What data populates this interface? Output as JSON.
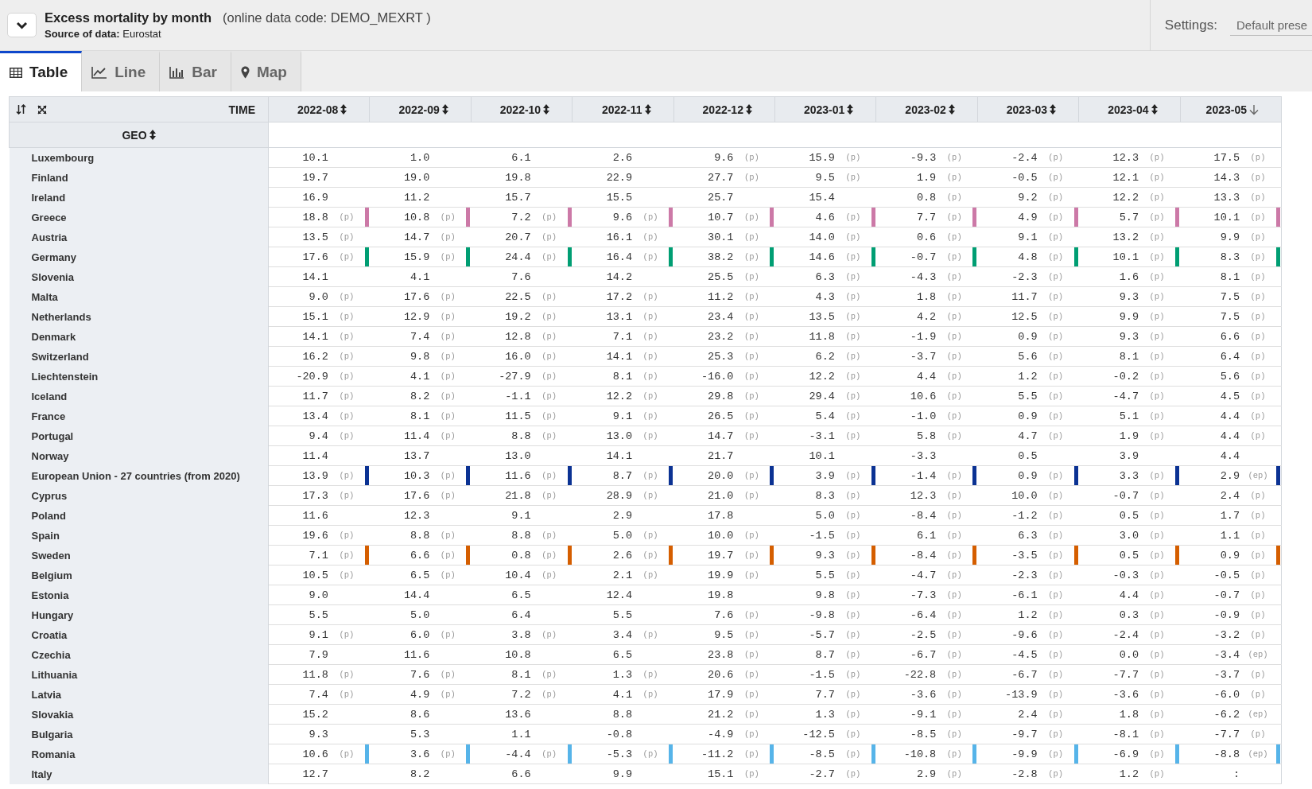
{
  "dataset": {
    "title": "Excess mortality by month",
    "code": "(online data code: DEMO_MEXRT )",
    "source": "**Source of data:** Eurostat"
  },
  "settings": {
    "label": "Settings:",
    "value": "Default prese"
  },
  "tabs": [
    {
      "label": "Table",
      "kind": "table",
      "selected": true
    },
    {
      "label": "Line",
      "kind": "line",
      "selected": false
    },
    {
      "label": "Bar",
      "kind": "bar",
      "selected": false
    },
    {
      "label": "Map",
      "kind": "map",
      "selected": false
    }
  ],
  "table": {
    "time_label": "TIME",
    "geo_label": "GEO",
    "columns": [
      {
        "label": "2022-08",
        "sorted": false
      },
      {
        "label": "2022-09",
        "sorted": false
      },
      {
        "label": "2022-10",
        "sorted": false
      },
      {
        "label": "2022-11",
        "sorted": false
      },
      {
        "label": "2022-12",
        "sorted": false
      },
      {
        "label": "2023-01",
        "sorted": false
      },
      {
        "label": "2023-02",
        "sorted": false
      },
      {
        "label": "2023-03",
        "sorted": false
      },
      {
        "label": "2023-04",
        "sorted": false
      },
      {
        "label": "2023-05",
        "sorted": true
      }
    ],
    "rows": [
      {
        "geo": "Luxembourg",
        "cells": [
          {
            "value": "10.1"
          },
          {
            "value": "1.0"
          },
          {
            "value": "6.1"
          },
          {
            "value": "2.6"
          },
          {
            "value": "9.6",
            "flag": "(p)"
          },
          {
            "value": "15.9",
            "flag": "(p)"
          },
          {
            "value": "-9.3",
            "flag": "(p)"
          },
          {
            "value": "-2.4",
            "flag": "(p)"
          },
          {
            "value": "12.3",
            "flag": "(p)"
          },
          {
            "value": "17.5",
            "flag": "(p)"
          }
        ]
      },
      {
        "geo": "Finland",
        "cells": [
          {
            "value": "19.7"
          },
          {
            "value": "19.0"
          },
          {
            "value": "19.8"
          },
          {
            "value": "22.9"
          },
          {
            "value": "27.7",
            "flag": "(p)"
          },
          {
            "value": "9.5",
            "flag": "(p)"
          },
          {
            "value": "1.9",
            "flag": "(p)"
          },
          {
            "value": "-0.5",
            "flag": "(p)"
          },
          {
            "value": "12.1",
            "flag": "(p)"
          },
          {
            "value": "14.3",
            "flag": "(p)"
          }
        ]
      },
      {
        "geo": "Ireland",
        "cells": [
          {
            "value": "16.9"
          },
          {
            "value": "11.2"
          },
          {
            "value": "15.7"
          },
          {
            "value": "15.5"
          },
          {
            "value": "25.7"
          },
          {
            "value": "15.4"
          },
          {
            "value": "0.8",
            "flag": "(p)"
          },
          {
            "value": "9.2",
            "flag": "(p)"
          },
          {
            "value": "12.2",
            "flag": "(p)"
          },
          {
            "value": "13.3",
            "flag": "(p)"
          }
        ]
      },
      {
        "geo": "Greece",
        "color": "#cc79a7",
        "cells": [
          {
            "value": "18.8",
            "flag": "(p)"
          },
          {
            "value": "10.8",
            "flag": "(p)"
          },
          {
            "value": "7.2",
            "flag": "(p)"
          },
          {
            "value": "9.6",
            "flag": "(p)"
          },
          {
            "value": "10.7",
            "flag": "(p)"
          },
          {
            "value": "4.6",
            "flag": "(p)"
          },
          {
            "value": "7.7",
            "flag": "(p)"
          },
          {
            "value": "4.9",
            "flag": "(p)"
          },
          {
            "value": "5.7",
            "flag": "(p)"
          },
          {
            "value": "10.1",
            "flag": "(p)"
          }
        ]
      },
      {
        "geo": "Austria",
        "cells": [
          {
            "value": "13.5",
            "flag": "(p)"
          },
          {
            "value": "14.7",
            "flag": "(p)"
          },
          {
            "value": "20.7",
            "flag": "(p)"
          },
          {
            "value": "16.1",
            "flag": "(p)"
          },
          {
            "value": "30.1",
            "flag": "(p)"
          },
          {
            "value": "14.0",
            "flag": "(p)"
          },
          {
            "value": "0.6",
            "flag": "(p)"
          },
          {
            "value": "9.1",
            "flag": "(p)"
          },
          {
            "value": "13.2",
            "flag": "(p)"
          },
          {
            "value": "9.9",
            "flag": "(p)"
          }
        ]
      },
      {
        "geo": "Germany",
        "color": "#009e73",
        "cells": [
          {
            "value": "17.6",
            "flag": "(p)"
          },
          {
            "value": "15.9",
            "flag": "(p)"
          },
          {
            "value": "24.4",
            "flag": "(p)"
          },
          {
            "value": "16.4",
            "flag": "(p)"
          },
          {
            "value": "38.2",
            "flag": "(p)"
          },
          {
            "value": "14.6",
            "flag": "(p)"
          },
          {
            "value": "-0.7",
            "flag": "(p)"
          },
          {
            "value": "4.8",
            "flag": "(p)"
          },
          {
            "value": "10.1",
            "flag": "(p)"
          },
          {
            "value": "8.3",
            "flag": "(p)"
          }
        ]
      },
      {
        "geo": "Slovenia",
        "cells": [
          {
            "value": "14.1"
          },
          {
            "value": "4.1"
          },
          {
            "value": "7.6"
          },
          {
            "value": "14.2"
          },
          {
            "value": "25.5",
            "flag": "(p)"
          },
          {
            "value": "6.3",
            "flag": "(p)"
          },
          {
            "value": "-4.3",
            "flag": "(p)"
          },
          {
            "value": "-2.3",
            "flag": "(p)"
          },
          {
            "value": "1.6",
            "flag": "(p)"
          },
          {
            "value": "8.1",
            "flag": "(p)"
          }
        ]
      },
      {
        "geo": "Malta",
        "cells": [
          {
            "value": "9.0",
            "flag": "(p)"
          },
          {
            "value": "17.6",
            "flag": "(p)"
          },
          {
            "value": "22.5",
            "flag": "(p)"
          },
          {
            "value": "17.2",
            "flag": "(p)"
          },
          {
            "value": "11.2",
            "flag": "(p)"
          },
          {
            "value": "4.3",
            "flag": "(p)"
          },
          {
            "value": "1.8",
            "flag": "(p)"
          },
          {
            "value": "11.7",
            "flag": "(p)"
          },
          {
            "value": "9.3",
            "flag": "(p)"
          },
          {
            "value": "7.5",
            "flag": "(p)"
          }
        ]
      },
      {
        "geo": "Netherlands",
        "cells": [
          {
            "value": "15.1",
            "flag": "(p)"
          },
          {
            "value": "12.9",
            "flag": "(p)"
          },
          {
            "value": "19.2",
            "flag": "(p)"
          },
          {
            "value": "13.1",
            "flag": "(p)"
          },
          {
            "value": "23.4",
            "flag": "(p)"
          },
          {
            "value": "13.5",
            "flag": "(p)"
          },
          {
            "value": "4.2",
            "flag": "(p)"
          },
          {
            "value": "12.5",
            "flag": "(p)"
          },
          {
            "value": "9.9",
            "flag": "(p)"
          },
          {
            "value": "7.5",
            "flag": "(p)"
          }
        ]
      },
      {
        "geo": "Denmark",
        "cells": [
          {
            "value": "14.1",
            "flag": "(p)"
          },
          {
            "value": "7.4",
            "flag": "(p)"
          },
          {
            "value": "12.8",
            "flag": "(p)"
          },
          {
            "value": "7.1",
            "flag": "(p)"
          },
          {
            "value": "23.2",
            "flag": "(p)"
          },
          {
            "value": "11.8",
            "flag": "(p)"
          },
          {
            "value": "-1.9",
            "flag": "(p)"
          },
          {
            "value": "0.9",
            "flag": "(p)"
          },
          {
            "value": "9.3",
            "flag": "(p)"
          },
          {
            "value": "6.6",
            "flag": "(p)"
          }
        ]
      },
      {
        "geo": "Switzerland",
        "cells": [
          {
            "value": "16.2",
            "flag": "(p)"
          },
          {
            "value": "9.8",
            "flag": "(p)"
          },
          {
            "value": "16.0",
            "flag": "(p)"
          },
          {
            "value": "14.1",
            "flag": "(p)"
          },
          {
            "value": "25.3",
            "flag": "(p)"
          },
          {
            "value": "6.2",
            "flag": "(p)"
          },
          {
            "value": "-3.7",
            "flag": "(p)"
          },
          {
            "value": "5.6",
            "flag": "(p)"
          },
          {
            "value": "8.1",
            "flag": "(p)"
          },
          {
            "value": "6.4",
            "flag": "(p)"
          }
        ]
      },
      {
        "geo": "Liechtenstein",
        "cells": [
          {
            "value": "-20.9",
            "flag": "(p)"
          },
          {
            "value": "4.1",
            "flag": "(p)"
          },
          {
            "value": "-27.9",
            "flag": "(p)"
          },
          {
            "value": "8.1",
            "flag": "(p)"
          },
          {
            "value": "-16.0",
            "flag": "(p)"
          },
          {
            "value": "12.2",
            "flag": "(p)"
          },
          {
            "value": "4.4",
            "flag": "(p)"
          },
          {
            "value": "1.2",
            "flag": "(p)"
          },
          {
            "value": "-0.2",
            "flag": "(p)"
          },
          {
            "value": "5.6",
            "flag": "(p)"
          }
        ]
      },
      {
        "geo": "Iceland",
        "cells": [
          {
            "value": "11.7",
            "flag": "(p)"
          },
          {
            "value": "8.2",
            "flag": "(p)"
          },
          {
            "value": "-1.1",
            "flag": "(p)"
          },
          {
            "value": "12.2",
            "flag": "(p)"
          },
          {
            "value": "29.8",
            "flag": "(p)"
          },
          {
            "value": "29.4",
            "flag": "(p)"
          },
          {
            "value": "10.6",
            "flag": "(p)"
          },
          {
            "value": "5.5",
            "flag": "(p)"
          },
          {
            "value": "-4.7",
            "flag": "(p)"
          },
          {
            "value": "4.5",
            "flag": "(p)"
          }
        ]
      },
      {
        "geo": "France",
        "cells": [
          {
            "value": "13.4",
            "flag": "(p)"
          },
          {
            "value": "8.1",
            "flag": "(p)"
          },
          {
            "value": "11.5",
            "flag": "(p)"
          },
          {
            "value": "9.1",
            "flag": "(p)"
          },
          {
            "value": "26.5",
            "flag": "(p)"
          },
          {
            "value": "5.4",
            "flag": "(p)"
          },
          {
            "value": "-1.0",
            "flag": "(p)"
          },
          {
            "value": "0.9",
            "flag": "(p)"
          },
          {
            "value": "5.1",
            "flag": "(p)"
          },
          {
            "value": "4.4",
            "flag": "(p)"
          }
        ]
      },
      {
        "geo": "Portugal",
        "cells": [
          {
            "value": "9.4",
            "flag": "(p)"
          },
          {
            "value": "11.4",
            "flag": "(p)"
          },
          {
            "value": "8.8",
            "flag": "(p)"
          },
          {
            "value": "13.0",
            "flag": "(p)"
          },
          {
            "value": "14.7",
            "flag": "(p)"
          },
          {
            "value": "-3.1",
            "flag": "(p)"
          },
          {
            "value": "5.8",
            "flag": "(p)"
          },
          {
            "value": "4.7",
            "flag": "(p)"
          },
          {
            "value": "1.9",
            "flag": "(p)"
          },
          {
            "value": "4.4",
            "flag": "(p)"
          }
        ]
      },
      {
        "geo": "Norway",
        "cells": [
          {
            "value": "11.4"
          },
          {
            "value": "13.7"
          },
          {
            "value": "13.0"
          },
          {
            "value": "14.1"
          },
          {
            "value": "21.7"
          },
          {
            "value": "10.1"
          },
          {
            "value": "-3.3"
          },
          {
            "value": "0.5"
          },
          {
            "value": "3.9"
          },
          {
            "value": "4.4"
          }
        ]
      },
      {
        "geo": "European Union - 27 countries (from 2020)",
        "color": "#0b3293",
        "cells": [
          {
            "value": "13.9",
            "flag": "(p)"
          },
          {
            "value": "10.3",
            "flag": "(p)"
          },
          {
            "value": "11.6",
            "flag": "(p)"
          },
          {
            "value": "8.7",
            "flag": "(p)"
          },
          {
            "value": "20.0",
            "flag": "(p)"
          },
          {
            "value": "3.9",
            "flag": "(p)"
          },
          {
            "value": "-1.4",
            "flag": "(p)"
          },
          {
            "value": "0.9",
            "flag": "(p)"
          },
          {
            "value": "3.3",
            "flag": "(p)"
          },
          {
            "value": "2.9",
            "flag": "(ep)"
          }
        ]
      },
      {
        "geo": "Cyprus",
        "cells": [
          {
            "value": "17.3",
            "flag": "(p)"
          },
          {
            "value": "17.6",
            "flag": "(p)"
          },
          {
            "value": "21.8",
            "flag": "(p)"
          },
          {
            "value": "28.9",
            "flag": "(p)"
          },
          {
            "value": "21.0",
            "flag": "(p)"
          },
          {
            "value": "8.3",
            "flag": "(p)"
          },
          {
            "value": "12.3",
            "flag": "(p)"
          },
          {
            "value": "10.0",
            "flag": "(p)"
          },
          {
            "value": "-0.7",
            "flag": "(p)"
          },
          {
            "value": "2.4",
            "flag": "(p)"
          }
        ]
      },
      {
        "geo": "Poland",
        "cells": [
          {
            "value": "11.6"
          },
          {
            "value": "12.3"
          },
          {
            "value": "9.1"
          },
          {
            "value": "2.9"
          },
          {
            "value": "17.8"
          },
          {
            "value": "5.0",
            "flag": "(p)"
          },
          {
            "value": "-8.4",
            "flag": "(p)"
          },
          {
            "value": "-1.2",
            "flag": "(p)"
          },
          {
            "value": "0.5",
            "flag": "(p)"
          },
          {
            "value": "1.7",
            "flag": "(p)"
          }
        ]
      },
      {
        "geo": "Spain",
        "cells": [
          {
            "value": "19.6",
            "flag": "(p)"
          },
          {
            "value": "8.8",
            "flag": "(p)"
          },
          {
            "value": "8.8",
            "flag": "(p)"
          },
          {
            "value": "5.0",
            "flag": "(p)"
          },
          {
            "value": "10.0",
            "flag": "(p)"
          },
          {
            "value": "-1.5",
            "flag": "(p)"
          },
          {
            "value": "6.1",
            "flag": "(p)"
          },
          {
            "value": "6.3",
            "flag": "(p)"
          },
          {
            "value": "3.0",
            "flag": "(p)"
          },
          {
            "value": "1.1",
            "flag": "(p)"
          }
        ]
      },
      {
        "geo": "Sweden",
        "color": "#d55e00",
        "cells": [
          {
            "value": "7.1",
            "flag": "(p)"
          },
          {
            "value": "6.6",
            "flag": "(p)"
          },
          {
            "value": "0.8",
            "flag": "(p)"
          },
          {
            "value": "2.6",
            "flag": "(p)"
          },
          {
            "value": "19.7",
            "flag": "(p)"
          },
          {
            "value": "9.3",
            "flag": "(p)"
          },
          {
            "value": "-8.4",
            "flag": "(p)"
          },
          {
            "value": "-3.5",
            "flag": "(p)"
          },
          {
            "value": "0.5",
            "flag": "(p)"
          },
          {
            "value": "0.9",
            "flag": "(p)"
          }
        ]
      },
      {
        "geo": "Belgium",
        "cells": [
          {
            "value": "10.5",
            "flag": "(p)"
          },
          {
            "value": "6.5",
            "flag": "(p)"
          },
          {
            "value": "10.4",
            "flag": "(p)"
          },
          {
            "value": "2.1",
            "flag": "(p)"
          },
          {
            "value": "19.9",
            "flag": "(p)"
          },
          {
            "value": "5.5",
            "flag": "(p)"
          },
          {
            "value": "-4.7",
            "flag": "(p)"
          },
          {
            "value": "-2.3",
            "flag": "(p)"
          },
          {
            "value": "-0.3",
            "flag": "(p)"
          },
          {
            "value": "-0.5",
            "flag": "(p)"
          }
        ]
      },
      {
        "geo": "Estonia",
        "cells": [
          {
            "value": "9.0"
          },
          {
            "value": "14.4"
          },
          {
            "value": "6.5"
          },
          {
            "value": "12.4"
          },
          {
            "value": "19.8"
          },
          {
            "value": "9.8",
            "flag": "(p)"
          },
          {
            "value": "-7.3",
            "flag": "(p)"
          },
          {
            "value": "-6.1",
            "flag": "(p)"
          },
          {
            "value": "4.4",
            "flag": "(p)"
          },
          {
            "value": "-0.7",
            "flag": "(p)"
          }
        ]
      },
      {
        "geo": "Hungary",
        "cells": [
          {
            "value": "5.5"
          },
          {
            "value": "5.0"
          },
          {
            "value": "6.4"
          },
          {
            "value": "5.5"
          },
          {
            "value": "7.6",
            "flag": "(p)"
          },
          {
            "value": "-9.8",
            "flag": "(p)"
          },
          {
            "value": "-6.4",
            "flag": "(p)"
          },
          {
            "value": "1.2",
            "flag": "(p)"
          },
          {
            "value": "0.3",
            "flag": "(p)"
          },
          {
            "value": "-0.9",
            "flag": "(p)"
          }
        ]
      },
      {
        "geo": "Croatia",
        "cells": [
          {
            "value": "9.1",
            "flag": "(p)"
          },
          {
            "value": "6.0",
            "flag": "(p)"
          },
          {
            "value": "3.8",
            "flag": "(p)"
          },
          {
            "value": "3.4",
            "flag": "(p)"
          },
          {
            "value": "9.5",
            "flag": "(p)"
          },
          {
            "value": "-5.7",
            "flag": "(p)"
          },
          {
            "value": "-2.5",
            "flag": "(p)"
          },
          {
            "value": "-9.6",
            "flag": "(p)"
          },
          {
            "value": "-2.4",
            "flag": "(p)"
          },
          {
            "value": "-3.2",
            "flag": "(p)"
          }
        ]
      },
      {
        "geo": "Czechia",
        "cells": [
          {
            "value": "7.9"
          },
          {
            "value": "11.6"
          },
          {
            "value": "10.8"
          },
          {
            "value": "6.5"
          },
          {
            "value": "23.8",
            "flag": "(p)"
          },
          {
            "value": "8.7",
            "flag": "(p)"
          },
          {
            "value": "-6.7",
            "flag": "(p)"
          },
          {
            "value": "-4.5",
            "flag": "(p)"
          },
          {
            "value": "0.0",
            "flag": "(p)"
          },
          {
            "value": "-3.4",
            "flag": "(ep)"
          }
        ]
      },
      {
        "geo": "Lithuania",
        "cells": [
          {
            "value": "11.8",
            "flag": "(p)"
          },
          {
            "value": "7.6",
            "flag": "(p)"
          },
          {
            "value": "8.1",
            "flag": "(p)"
          },
          {
            "value": "1.3",
            "flag": "(p)"
          },
          {
            "value": "20.6",
            "flag": "(p)"
          },
          {
            "value": "-1.5",
            "flag": "(p)"
          },
          {
            "value": "-22.8",
            "flag": "(p)"
          },
          {
            "value": "-6.7",
            "flag": "(p)"
          },
          {
            "value": "-7.7",
            "flag": "(p)"
          },
          {
            "value": "-3.7",
            "flag": "(p)"
          }
        ]
      },
      {
        "geo": "Latvia",
        "cells": [
          {
            "value": "7.4",
            "flag": "(p)"
          },
          {
            "value": "4.9",
            "flag": "(p)"
          },
          {
            "value": "7.2",
            "flag": "(p)"
          },
          {
            "value": "4.1",
            "flag": "(p)"
          },
          {
            "value": "17.9",
            "flag": "(p)"
          },
          {
            "value": "7.7",
            "flag": "(p)"
          },
          {
            "value": "-3.6",
            "flag": "(p)"
          },
          {
            "value": "-13.9",
            "flag": "(p)"
          },
          {
            "value": "-3.6",
            "flag": "(p)"
          },
          {
            "value": "-6.0",
            "flag": "(p)"
          }
        ]
      },
      {
        "geo": "Slovakia",
        "cells": [
          {
            "value": "15.2"
          },
          {
            "value": "8.6"
          },
          {
            "value": "13.6"
          },
          {
            "value": "8.8"
          },
          {
            "value": "21.2",
            "flag": "(p)"
          },
          {
            "value": "1.3",
            "flag": "(p)"
          },
          {
            "value": "-9.1",
            "flag": "(p)"
          },
          {
            "value": "2.4",
            "flag": "(p)"
          },
          {
            "value": "1.8",
            "flag": "(p)"
          },
          {
            "value": "-6.2",
            "flag": "(ep)"
          }
        ]
      },
      {
        "geo": "Bulgaria",
        "cells": [
          {
            "value": "9.3"
          },
          {
            "value": "5.3"
          },
          {
            "value": "1.1"
          },
          {
            "value": "-0.8"
          },
          {
            "value": "-4.9",
            "flag": "(p)"
          },
          {
            "value": "-12.5",
            "flag": "(p)"
          },
          {
            "value": "-8.5",
            "flag": "(p)"
          },
          {
            "value": "-9.7",
            "flag": "(p)"
          },
          {
            "value": "-8.1",
            "flag": "(p)"
          },
          {
            "value": "-7.7",
            "flag": "(p)"
          }
        ]
      },
      {
        "geo": "Romania",
        "color": "#56b4e9",
        "cells": [
          {
            "value": "10.6",
            "flag": "(p)"
          },
          {
            "value": "3.6",
            "flag": "(p)"
          },
          {
            "value": "-4.4",
            "flag": "(p)"
          },
          {
            "value": "-5.3",
            "flag": "(p)"
          },
          {
            "value": "-11.2",
            "flag": "(p)"
          },
          {
            "value": "-8.5",
            "flag": "(p)"
          },
          {
            "value": "-10.8",
            "flag": "(p)"
          },
          {
            "value": "-9.9",
            "flag": "(p)"
          },
          {
            "value": "-6.9",
            "flag": "(p)"
          },
          {
            "value": "-8.8",
            "flag": "(ep)"
          }
        ]
      },
      {
        "geo": "Italy",
        "cells": [
          {
            "value": "12.7"
          },
          {
            "value": "8.2"
          },
          {
            "value": "6.6"
          },
          {
            "value": "9.9"
          },
          {
            "value": "15.1",
            "flag": "(p)"
          },
          {
            "value": "-2.7",
            "flag": "(p)"
          },
          {
            "value": "2.9",
            "flag": "(p)"
          },
          {
            "value": "-2.8",
            "flag": "(p)"
          },
          {
            "value": "1.2",
            "flag": "(p)"
          },
          {
            "value": ":"
          }
        ]
      }
    ]
  }
}
